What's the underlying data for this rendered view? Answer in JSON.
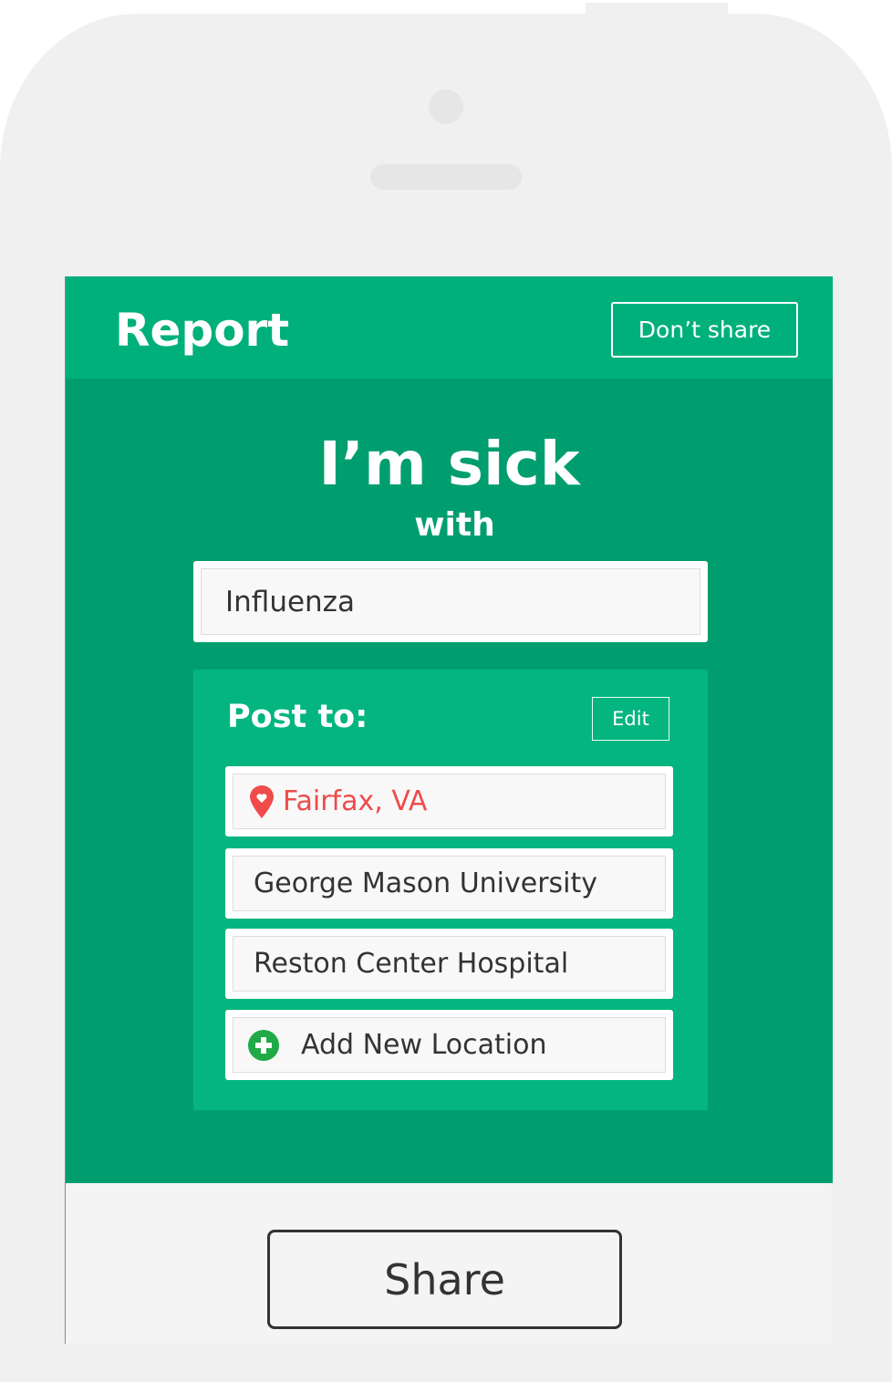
{
  "header": {
    "title": "Report",
    "dont_share": "Don’t share"
  },
  "main": {
    "headline": "I’m sick",
    "subhead": "with",
    "disease_value": "Influenza"
  },
  "post": {
    "label": "Post to:",
    "edit": "Edit",
    "locations": [
      {
        "label": "Fairfax, VA",
        "icon": "map-pin-heart-icon",
        "color": "#ef4b4b"
      },
      {
        "label": "George Mason University"
      },
      {
        "label": "Reston Center Hospital"
      },
      {
        "label": "Add New Location",
        "icon": "plus-circle-icon",
        "color": "#1faa47"
      }
    ]
  },
  "footer": {
    "share": "Share"
  },
  "colors": {
    "header": "#00b07b",
    "body": "#009e6f",
    "panel": "#04b57f"
  }
}
